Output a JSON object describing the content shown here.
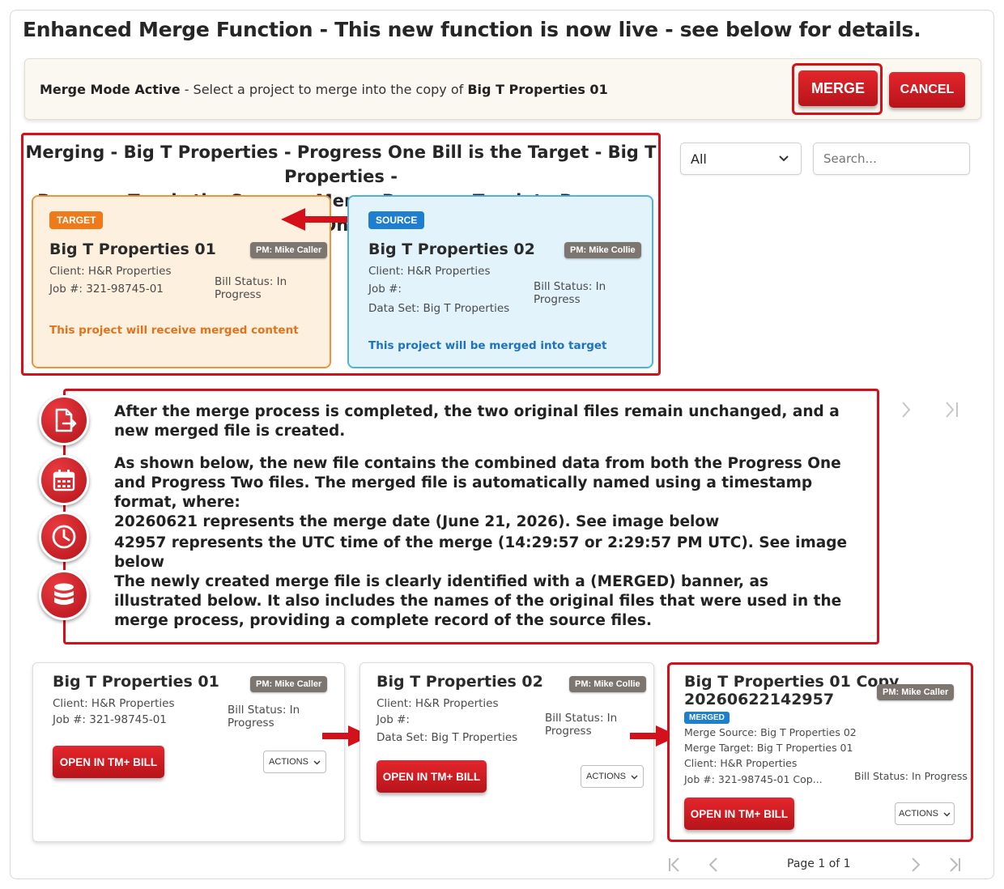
{
  "page": {
    "title": "Enhanced Merge Function - This new function is now live - see below for details."
  },
  "mode_bar": {
    "label_bold": "Merge Mode Active",
    "text": " - Select a project to merge into the copy of ",
    "project": "Big T Properties 01",
    "merge_label": "MERGE",
    "cancel_label": "CANCEL"
  },
  "filter": {
    "selected": "All",
    "search_placeholder": "Search..."
  },
  "merging": {
    "title_line1": "Merging - Big T Properties - Progress One Bill is the Target -  Big T Properties -",
    "title_line2": "Progress Two is the Source - Merge Progress Two into Progress One",
    "target": {
      "badge": "TARGET",
      "name": "Big T Properties 01",
      "pm": "PM: Mike Caller",
      "client": "Client: H&R Properties",
      "job": "Job #: 321-98745-01",
      "status": "Bill Status: In Progress",
      "note": "This project will receive merged content"
    },
    "source": {
      "badge": "SOURCE",
      "name": "Big T Properties 02",
      "pm": "PM: Mike Collie",
      "client": "Client: H&R Properties",
      "job": "Job #:",
      "dataset": "Data Set: Big T Properties",
      "status": "Bill Status: In Progress",
      "note": "This project will be merged into target"
    }
  },
  "info": {
    "p1": "After the merge process is completed, the two original files remain unchanged, and a new merged file is created.",
    "p2": "As shown below, the new file contains the combined data from both the Progress One and Progress Two files. The merged file is automatically named using a timestamp format, where:",
    "p3a": "20260621 represents the merge date (June 21, 2026). See image below",
    "p3b": "42957 represents the UTC time of the merge (14:29:57 or 2:29:57 PM UTC). See image below",
    "p4": "The newly created merge file is clearly identified with a (MERGED) banner, as illustrated below. It also includes the names of the original files that were used in the merge process, providing a complete record of the source files."
  },
  "cards": [
    {
      "name": "Big T Properties 01",
      "pm": "PM: Mike Caller",
      "client": "Client: H&R Properties",
      "job": "Job #: 321-98745-01",
      "status": "Bill Status: In Progress",
      "open_label": "OPEN IN TM+ BILL",
      "actions_label": "ACTIONS"
    },
    {
      "name": "Big T Properties 02",
      "pm": "PM: Mike Collie",
      "client": "Client: H&R Properties",
      "job": "Job #:",
      "dataset": "Data Set: Big T Properties",
      "status": "Bill Status: In Progress",
      "open_label": "OPEN IN TM+ BILL",
      "actions_label": "ACTIONS"
    },
    {
      "name_line1": "Big T Properties 01 Copy",
      "name_line2": "20260622142957",
      "merged_badge": "MERGED",
      "pm": "PM: Mike Caller",
      "merge_source": "Merge Source: Big T Properties 02",
      "merge_target": "Merge Target: Big T Properties 01",
      "client": "Client: H&R Properties",
      "job": "Job #: 321-98745-01 Cop...",
      "status": "Bill Status: In Progress",
      "open_label": "OPEN IN TM+ BILL",
      "actions_label": "ACTIONS"
    }
  ],
  "pagination": {
    "label": "Page 1 of 1"
  },
  "colors": {
    "accent_red": "#d4111b",
    "target_orange": "#f0923a",
    "source_blue": "#4eb2e3"
  },
  "icons": [
    "file-export-icon",
    "calendar-icon",
    "clock-icon",
    "database-icon",
    "arrow-left-icon",
    "arrow-right-icon",
    "chevron-down-icon"
  ]
}
